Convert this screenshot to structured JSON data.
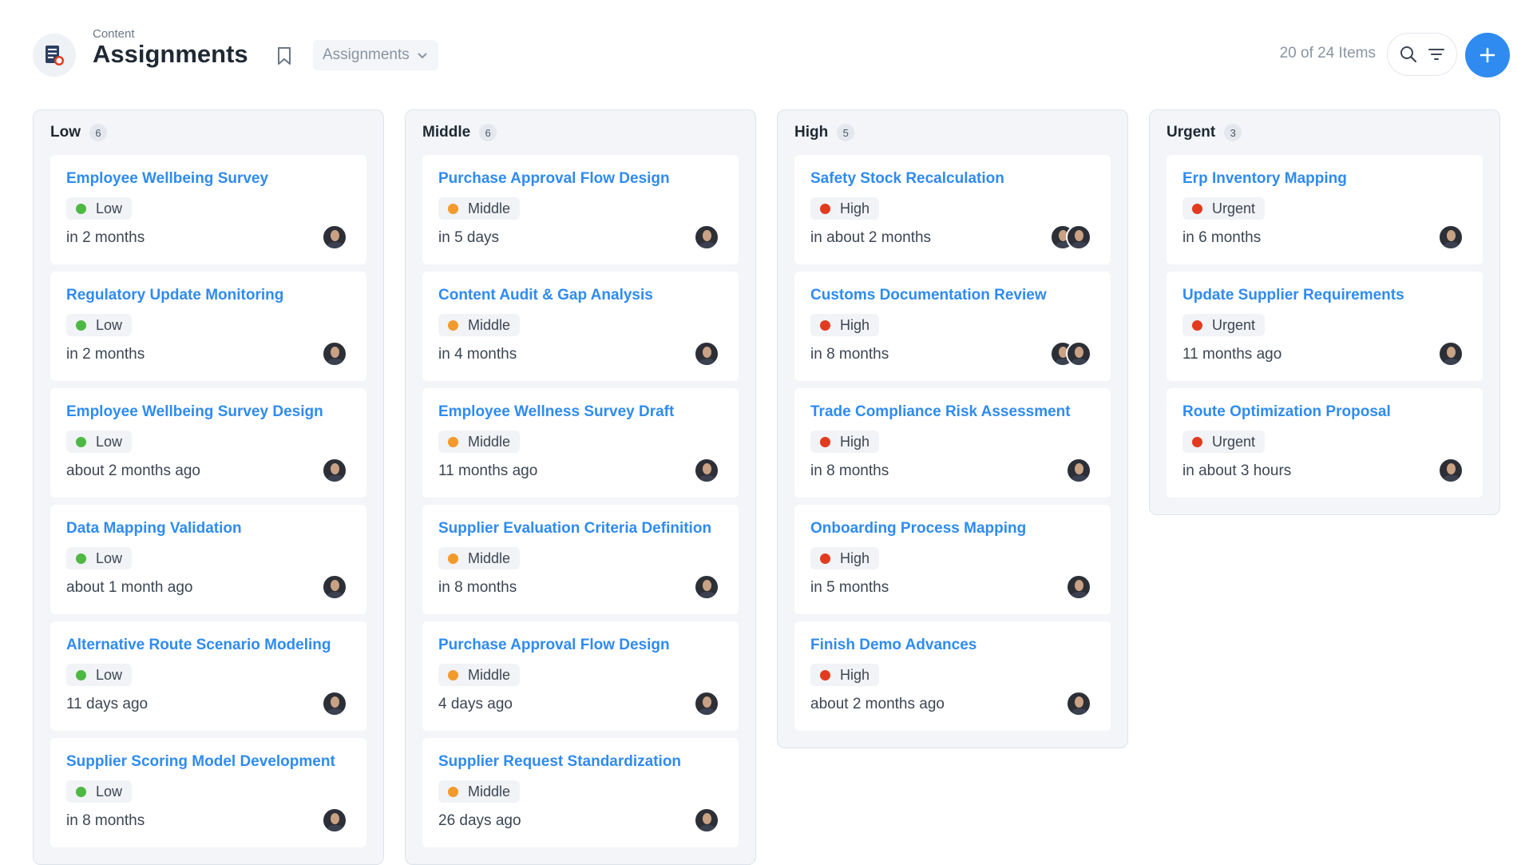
{
  "header": {
    "breadcrumb": "Content",
    "title": "Assignments",
    "view_select": "Assignments",
    "items_count": "20 of 24 Items"
  },
  "icons": {
    "app": "assignments-app-icon",
    "bookmark": "bookmark-icon",
    "chevron": "chevron-down-icon",
    "search": "search-icon",
    "filter": "filter-icon",
    "add": "plus-icon"
  },
  "colors": {
    "accent": "#2f8bf0",
    "low": "#4fb845",
    "middle": "#f39a2c",
    "high": "#e23b20",
    "urgent": "#e23b20"
  },
  "columns": [
    {
      "title": "Low",
      "count": "6",
      "cards": [
        {
          "title": "Employee Wellbeing Survey",
          "priority": "Low",
          "due": "in 2 months",
          "avatars": 1
        },
        {
          "title": "Regulatory Update Monitoring",
          "priority": "Low",
          "due": "in 2 months",
          "avatars": 1
        },
        {
          "title": "Employee Wellbeing Survey Design",
          "priority": "Low",
          "due": "about 2 months ago",
          "avatars": 1
        },
        {
          "title": "Data Mapping Validation",
          "priority": "Low",
          "due": "about 1 month ago",
          "avatars": 1
        },
        {
          "title": "Alternative Route Scenario Modeling",
          "priority": "Low",
          "due": "11 days ago",
          "avatars": 1
        },
        {
          "title": "Supplier Scoring Model Development",
          "priority": "Low",
          "due": "in 8 months",
          "avatars": 1
        }
      ]
    },
    {
      "title": "Middle",
      "count": "6",
      "cards": [
        {
          "title": "Purchase Approval Flow Design",
          "priority": "Middle",
          "due": "in 5 days",
          "avatars": 1
        },
        {
          "title": "Content Audit & Gap Analysis",
          "priority": "Middle",
          "due": "in 4 months",
          "avatars": 1
        },
        {
          "title": "Employee Wellness Survey Draft",
          "priority": "Middle",
          "due": "11 months ago",
          "avatars": 1
        },
        {
          "title": "Supplier Evaluation Criteria Definition",
          "priority": "Middle",
          "due": "in 8 months",
          "avatars": 1
        },
        {
          "title": "Purchase Approval Flow Design",
          "priority": "Middle",
          "due": "4 days ago",
          "avatars": 1
        },
        {
          "title": "Supplier Request Standardization",
          "priority": "Middle",
          "due": "26 days ago",
          "avatars": 1
        }
      ]
    },
    {
      "title": "High",
      "count": "5",
      "cards": [
        {
          "title": "Safety Stock Recalculation",
          "priority": "High",
          "due": "in about 2 months",
          "avatars": 2
        },
        {
          "title": "Customs Documentation Review",
          "priority": "High",
          "due": "in 8 months",
          "avatars": 2
        },
        {
          "title": "Trade Compliance Risk Assessment",
          "priority": "High",
          "due": "in 8 months",
          "avatars": 1
        },
        {
          "title": "Onboarding Process Mapping",
          "priority": "High",
          "due": "in 5 months",
          "avatars": 1
        },
        {
          "title": "Finish Demo Advances",
          "priority": "High",
          "due": "about 2 months ago",
          "avatars": 1
        }
      ]
    },
    {
      "title": "Urgent",
      "count": "3",
      "cards": [
        {
          "title": "Erp Inventory Mapping",
          "priority": "Urgent",
          "due": "in 6 months",
          "avatars": 1
        },
        {
          "title": "Update Supplier Requirements",
          "priority": "Urgent",
          "due": "11 months ago",
          "avatars": 1
        },
        {
          "title": "Route Optimization Proposal",
          "priority": "Urgent",
          "due": "in about 3 hours",
          "avatars": 1
        }
      ]
    }
  ]
}
